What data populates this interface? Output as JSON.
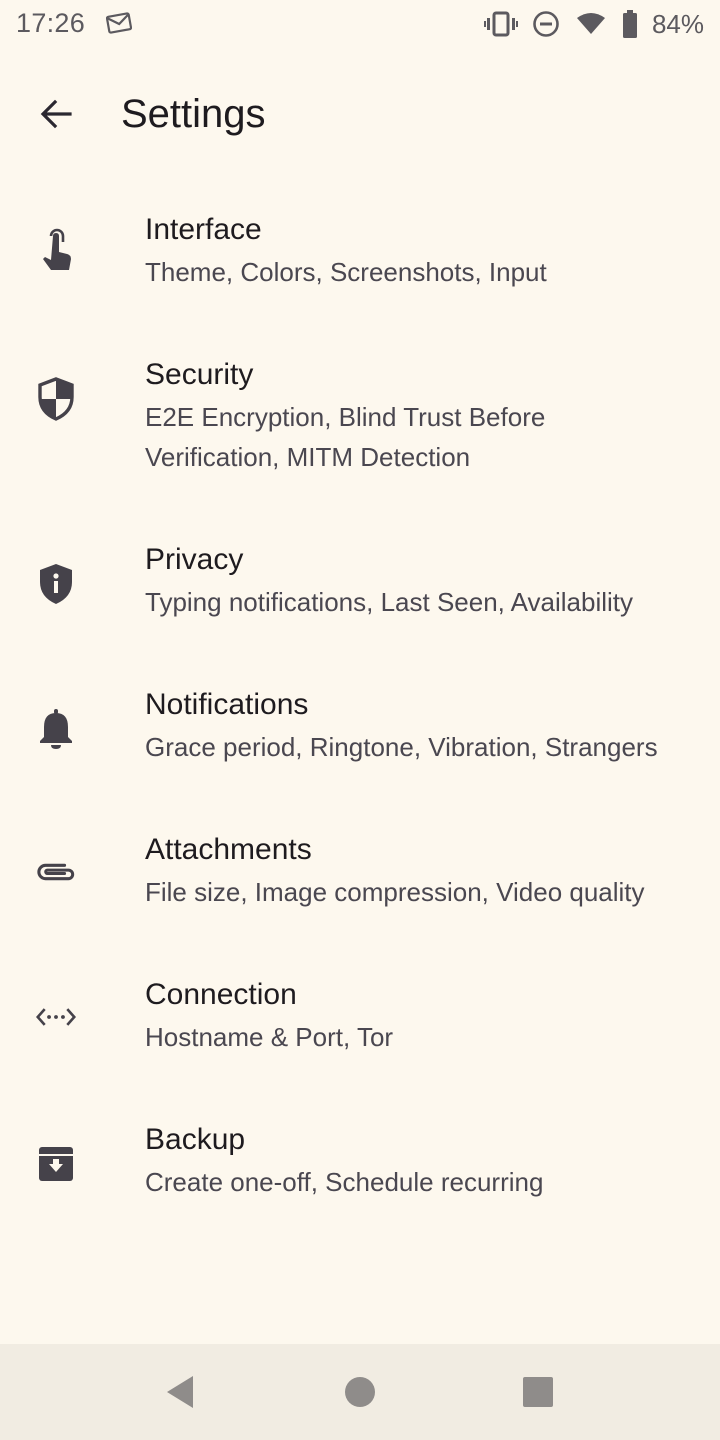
{
  "status_bar": {
    "time": "17:26",
    "battery_percent": "84%",
    "icons": [
      "mail-icon",
      "vibrate-icon",
      "do-not-disturb-icon",
      "wifi-icon",
      "battery-icon"
    ]
  },
  "app_bar": {
    "title": "Settings",
    "back_icon": "arrow-back-icon"
  },
  "settings": {
    "items": [
      {
        "title": "Interface",
        "subtitle": "Theme, Colors, Screenshots, Input",
        "icon": "touch-hand-icon"
      },
      {
        "title": "Security",
        "subtitle": "E2E Encryption, Blind Trust Before Verification, MITM Detection",
        "icon": "shield-icon"
      },
      {
        "title": "Privacy",
        "subtitle": "Typing notifications, Last Seen, Availability",
        "icon": "privacy-shield-icon"
      },
      {
        "title": "Notifications",
        "subtitle": "Grace period, Ringtone, Vibration, Strangers",
        "icon": "bell-icon"
      },
      {
        "title": "Attachments",
        "subtitle": "File size, Image compression, Video quality",
        "icon": "attachment-icon"
      },
      {
        "title": "Connection",
        "subtitle": "Hostname & Port, Tor",
        "icon": "code-dots-icon"
      },
      {
        "title": "Backup",
        "subtitle": "Create one-off, Schedule recurring",
        "icon": "archive-icon"
      }
    ]
  },
  "nav_bar": {
    "buttons": [
      "nav-back-icon",
      "nav-home-icon",
      "nav-recents-icon"
    ]
  },
  "colors": {
    "background": "#fdf8ee",
    "icon": "#45424a",
    "nav_bar": "#f1ece2"
  }
}
